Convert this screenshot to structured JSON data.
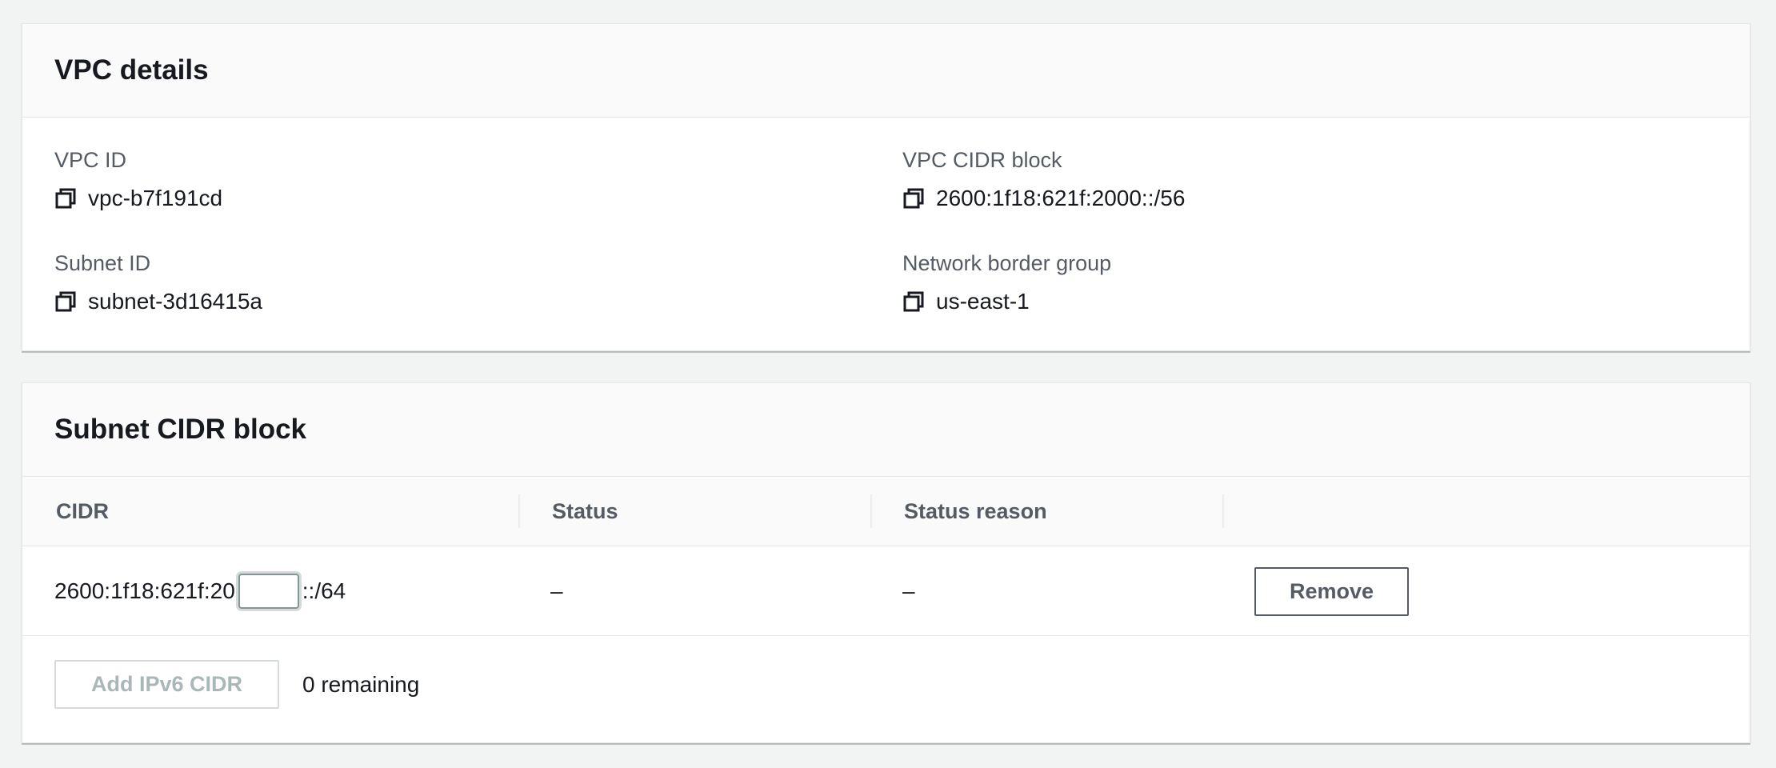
{
  "vpc_details": {
    "title": "VPC details",
    "vpc_id": {
      "label": "VPC ID",
      "value": "vpc-b7f191cd"
    },
    "vpc_cidr_block": {
      "label": "VPC CIDR block",
      "value": "2600:1f18:621f:2000::/56"
    },
    "subnet_id": {
      "label": "Subnet ID",
      "value": "subnet-3d16415a"
    },
    "network_border_group": {
      "label": "Network border group",
      "value": "us-east-1"
    }
  },
  "subnet_cidr": {
    "title": "Subnet CIDR block",
    "columns": [
      "CIDR",
      "Status",
      "Status reason"
    ],
    "rows": [
      {
        "cidr_prefix": "2600:1f18:621f:20",
        "cidr_input_value": "",
        "cidr_suffix": "::/64",
        "status": "–",
        "status_reason": "–",
        "remove_label": "Remove"
      }
    ],
    "add_button_label": "Add IPv6 CIDR",
    "remaining_text": "0 remaining"
  },
  "icons": {
    "copy": "copy-icon"
  },
  "colors": {
    "page_background": "#f2f3f3",
    "panel_header_background": "#fafafa",
    "label_text": "#545b64",
    "disabled_text": "#aab7b8"
  }
}
